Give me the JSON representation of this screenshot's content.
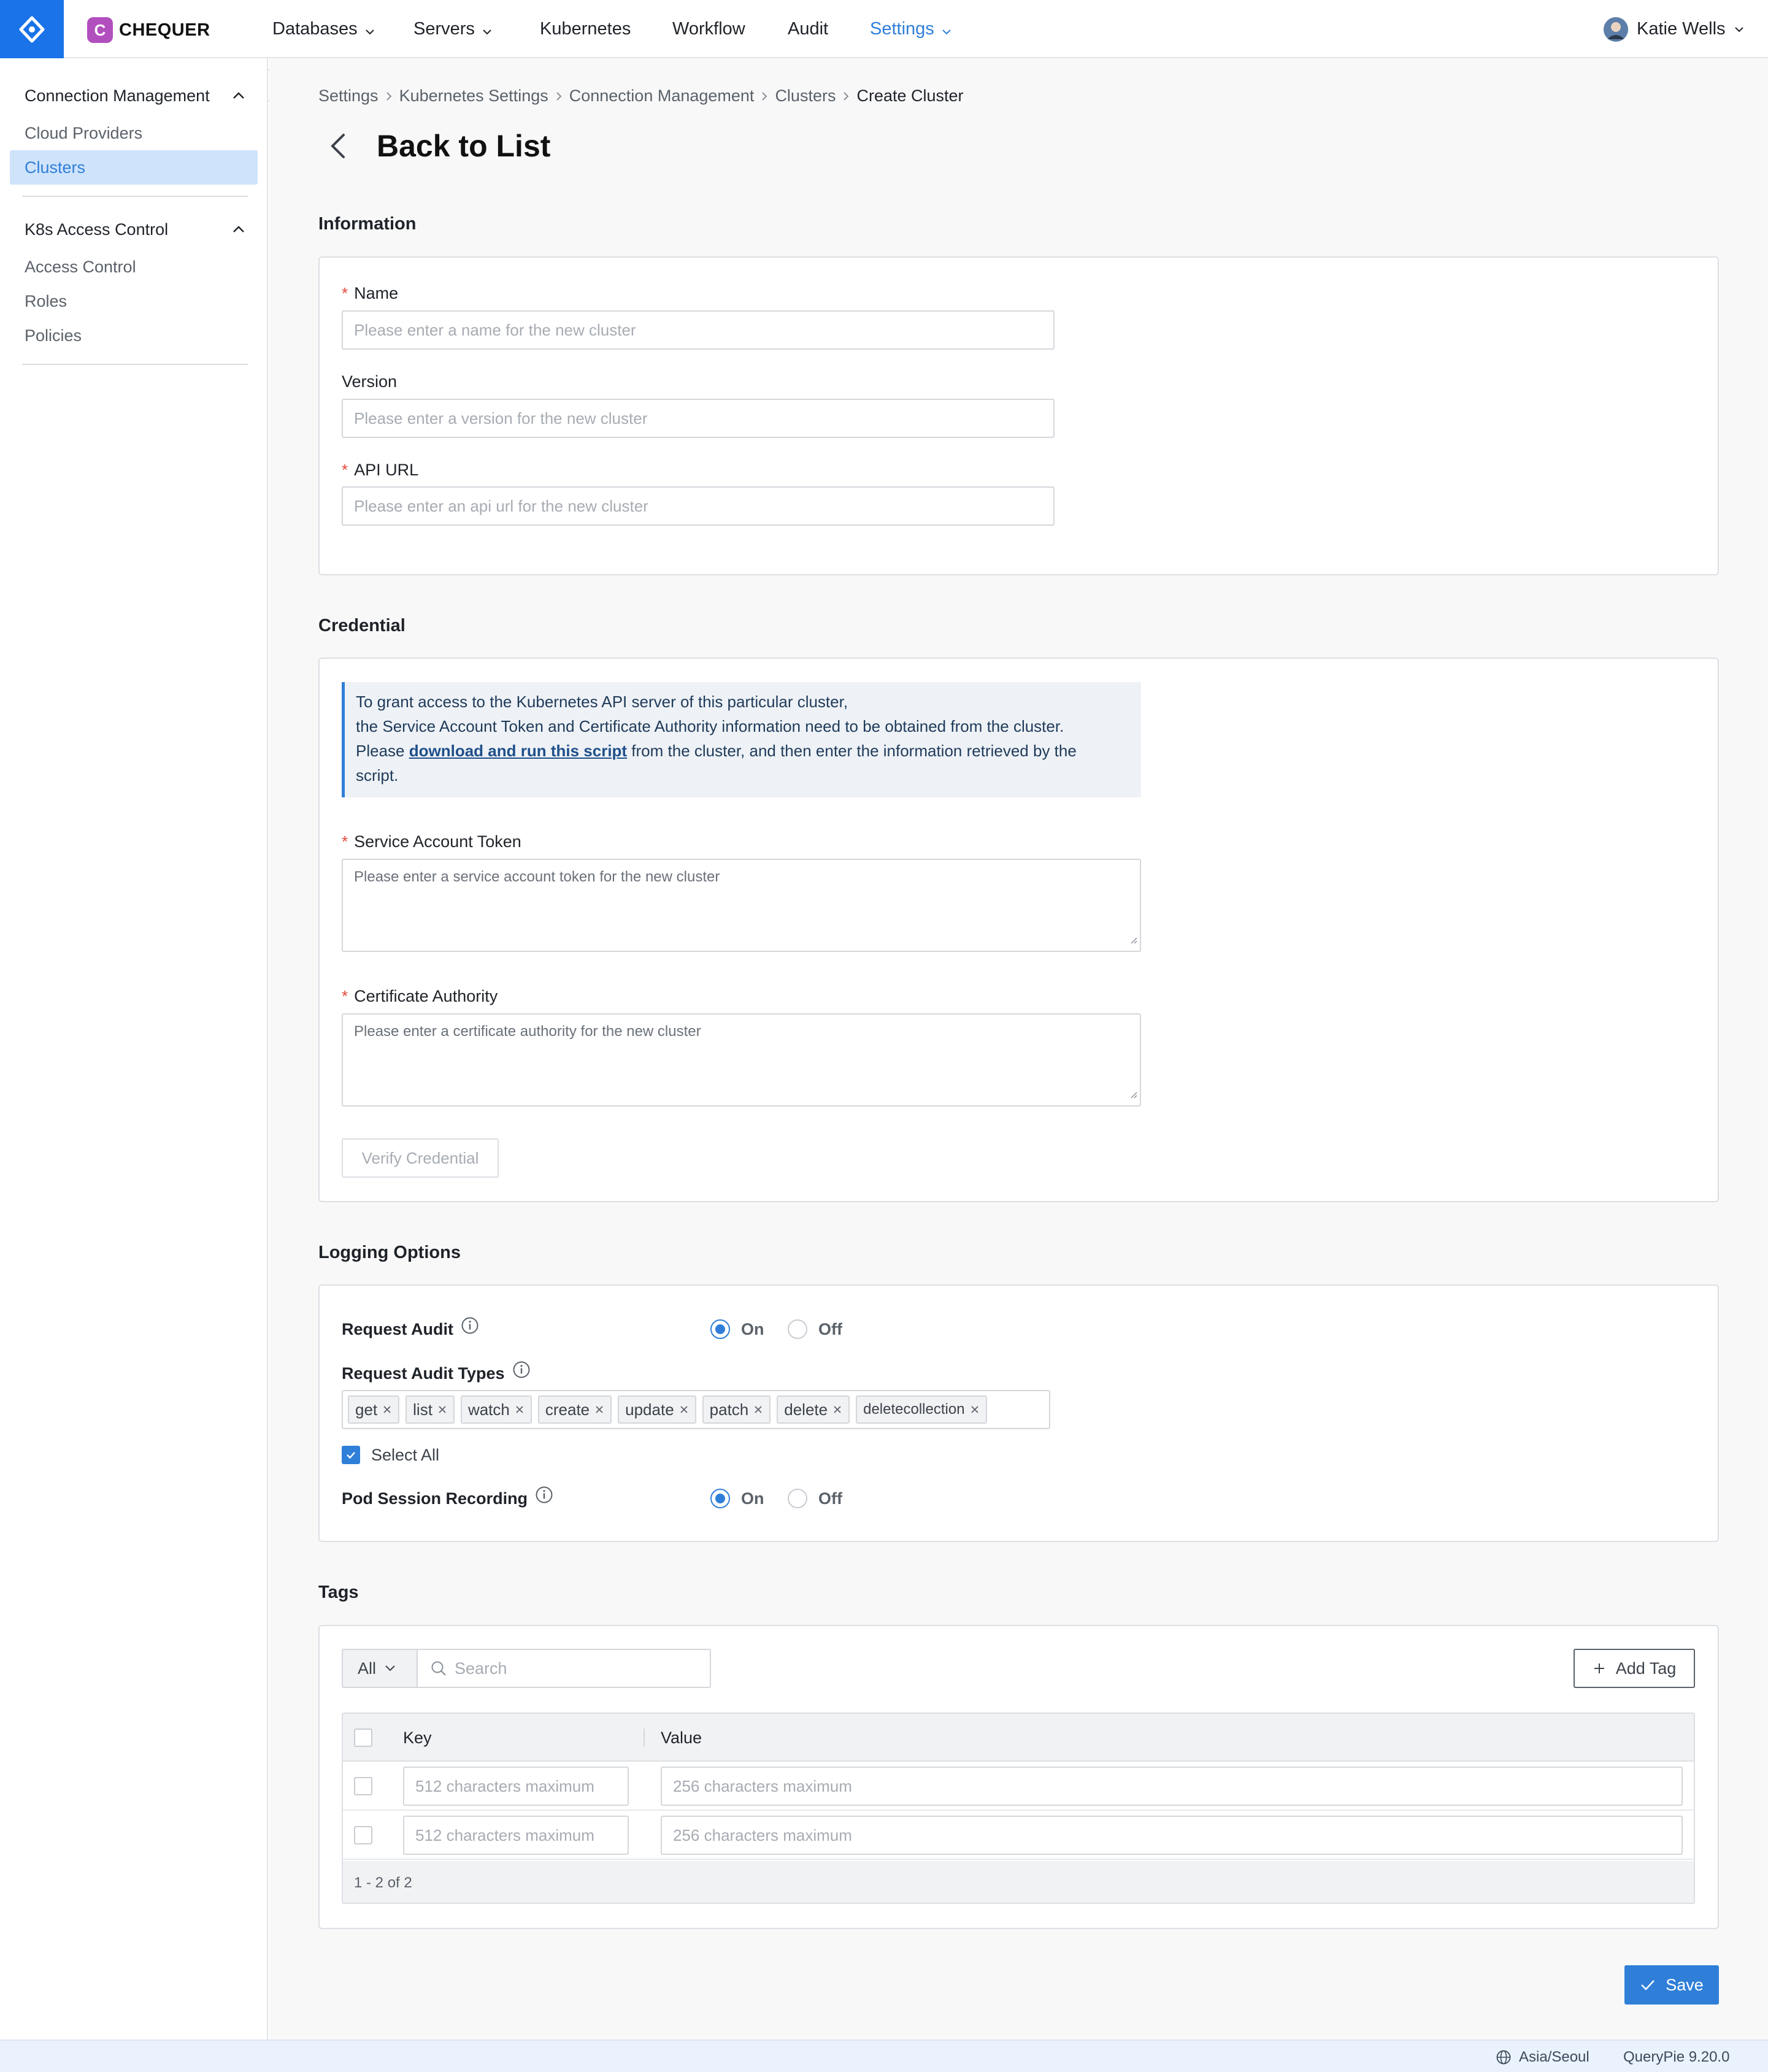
{
  "header": {
    "org_initial": "C",
    "org_name": "CHEQUER",
    "nav": [
      {
        "label": "Databases",
        "has_dropdown": true
      },
      {
        "label": "Servers",
        "has_dropdown": true
      },
      {
        "label": "Kubernetes",
        "has_dropdown": false
      },
      {
        "label": "Workflow",
        "has_dropdown": false
      },
      {
        "label": "Audit",
        "has_dropdown": false
      },
      {
        "label": "Settings",
        "has_dropdown": true,
        "active": true
      }
    ],
    "user_name": "Katie Wells"
  },
  "sidebar": {
    "groups": [
      {
        "label": "Connection Management",
        "expanded": true,
        "items": [
          "Cloud Providers",
          "Clusters"
        ]
      },
      {
        "label": "K8s Access Control",
        "expanded": true,
        "items": [
          "Access Control",
          "Roles",
          "Policies"
        ]
      }
    ],
    "selected_item": "Clusters"
  },
  "breadcrumb": [
    "Settings",
    "Kubernetes Settings",
    "Connection Management",
    "Clusters",
    "Create Cluster"
  ],
  "page_title": "Back to List",
  "information": {
    "section_title": "Information",
    "name": {
      "label": "Name",
      "required": true,
      "value": "",
      "placeholder": "Please enter a name for the new cluster"
    },
    "version": {
      "label": "Version",
      "required": false,
      "value": "",
      "placeholder": "Please enter a version for the new cluster"
    },
    "api_url": {
      "label": "API URL",
      "required": true,
      "value": "",
      "placeholder": "Please enter an api url for the new cluster"
    }
  },
  "credential": {
    "section_title": "Credential",
    "callout": {
      "line1": "To grant access to the Kubernetes API server of this particular cluster,",
      "line2": "the Service Account Token and Certificate Authority information need to be obtained from the cluster.",
      "line3_pre": "Please ",
      "line3_link": "download and run this script",
      "line3_post": " from the cluster, and then enter the information retrieved by the",
      "line4": "script."
    },
    "token": {
      "label": "Service Account Token",
      "required": true,
      "value": "",
      "placeholder": "Please enter a service account token for the new cluster"
    },
    "ca": {
      "label": "Certificate Authority",
      "required": true,
      "value": "",
      "placeholder": "Please enter a certificate authority for the new cluster"
    },
    "verify_label": "Verify Credential"
  },
  "logging": {
    "section_title": "Logging Options",
    "request_audit": {
      "label": "Request Audit",
      "selected": "On",
      "on_label": "On",
      "off_label": "Off"
    },
    "audit_types": {
      "label": "Request Audit Types",
      "values": [
        "get",
        "list",
        "watch",
        "create",
        "update",
        "patch",
        "delete",
        "deletecollection"
      ]
    },
    "select_all": {
      "label": "Select All",
      "checked": true
    },
    "pod_recording": {
      "label": "Pod Session Recording",
      "selected": "On",
      "on_label": "On",
      "off_label": "Off"
    }
  },
  "tags": {
    "section_title": "Tags",
    "filter_value": "All",
    "search_placeholder": "Search",
    "add_label": "Add Tag",
    "columns": [
      "Key",
      "Value"
    ],
    "rows": [
      {
        "key": "",
        "key_placeholder": "512 characters maximum",
        "value": "",
        "value_placeholder": "256 characters maximum"
      },
      {
        "key": "",
        "key_placeholder": "512 characters maximum",
        "value": "",
        "value_placeholder": "256 characters maximum"
      }
    ],
    "pagination": "1 - 2 of 2"
  },
  "save_label": "Save",
  "status_bar": {
    "timezone": "Asia/Seoul",
    "version": "QueryPie 9.20.0"
  },
  "colors": {
    "accent": "#2f7fd8",
    "brand": "#1a73e8",
    "org_badge": "#b24fbe",
    "required": "#e5483a"
  }
}
